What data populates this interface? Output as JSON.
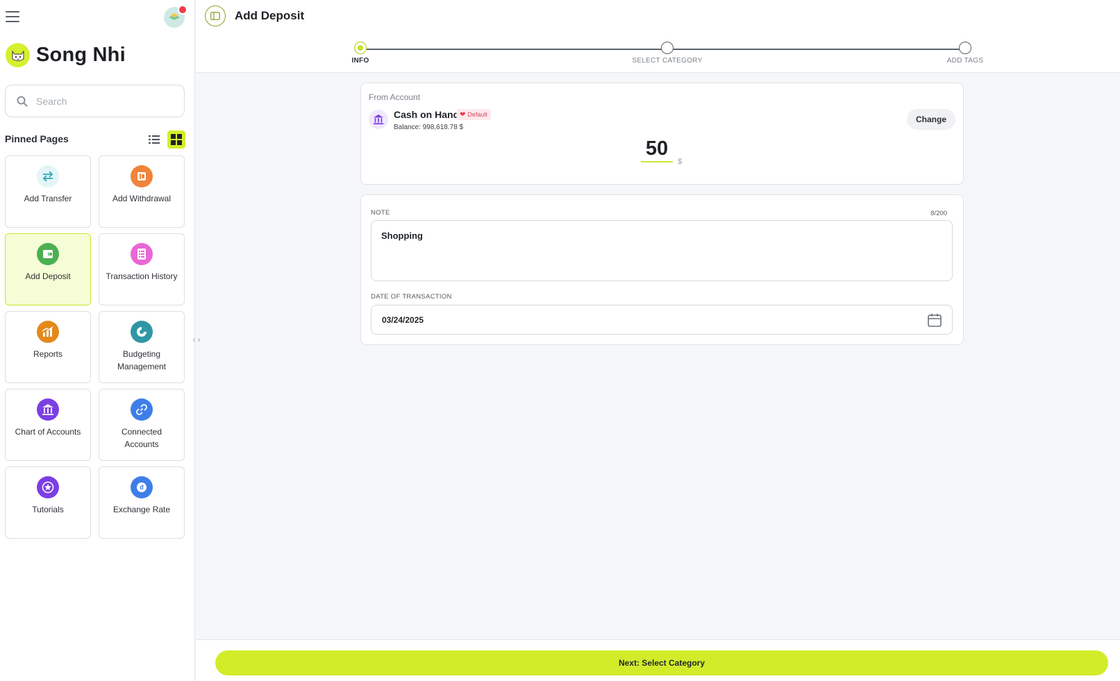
{
  "sidebar": {
    "user_name": "Song Nhi",
    "search_placeholder": "Search",
    "pinned_title": "Pinned Pages",
    "cards": [
      {
        "label": "Add Transfer",
        "icon": "transfer-icon",
        "color": "#e3f5f8"
      },
      {
        "label": "Add Withdrawal",
        "icon": "withdrawal-icon",
        "color": "#f0843a"
      },
      {
        "label": "Add Deposit",
        "icon": "deposit-icon",
        "color": "#4caf50"
      },
      {
        "label": "Transaction History",
        "icon": "history-icon",
        "color": "#e967d6"
      },
      {
        "label": "Reports",
        "icon": "reports-icon",
        "color": "#e38a1a"
      },
      {
        "label": "Budgeting Management",
        "icon": "budget-icon",
        "color": "#2f96a6"
      },
      {
        "label": "Chart of Accounts",
        "icon": "bank-icon",
        "color": "#7b3fe4"
      },
      {
        "label": "Connected Accounts",
        "icon": "link-icon",
        "color": "#3f7ee8"
      },
      {
        "label": "Tutorials",
        "icon": "star-icon",
        "color": "#7b3fe4"
      },
      {
        "label": "Exchange Rate",
        "icon": "exchange-icon",
        "color": "#3f7ee8"
      }
    ]
  },
  "header": {
    "title": "Add Deposit"
  },
  "steps": [
    {
      "label": "INFO",
      "state": "current"
    },
    {
      "label": "SELECT CATEGORY",
      "state": "pending"
    },
    {
      "label": "ADD TAGS",
      "state": "pending"
    }
  ],
  "account": {
    "from_label": "From Account",
    "name": "Cash on Hand",
    "badge": "Default",
    "balance_label": "Balance:",
    "balance_value": "998,618.78 $",
    "change_label": "Change",
    "amount": "50",
    "currency": "$"
  },
  "form": {
    "note_label": "NOTE",
    "note_counter": "8/200",
    "note_value": "Shopping",
    "date_label": "DATE OF TRANSACTION",
    "date_value": "03/24/2025"
  },
  "footer": {
    "next_label": "Next: Select Category"
  },
  "colors": {
    "accent": "#d2ec2a",
    "default_badge": "#e0465e"
  }
}
